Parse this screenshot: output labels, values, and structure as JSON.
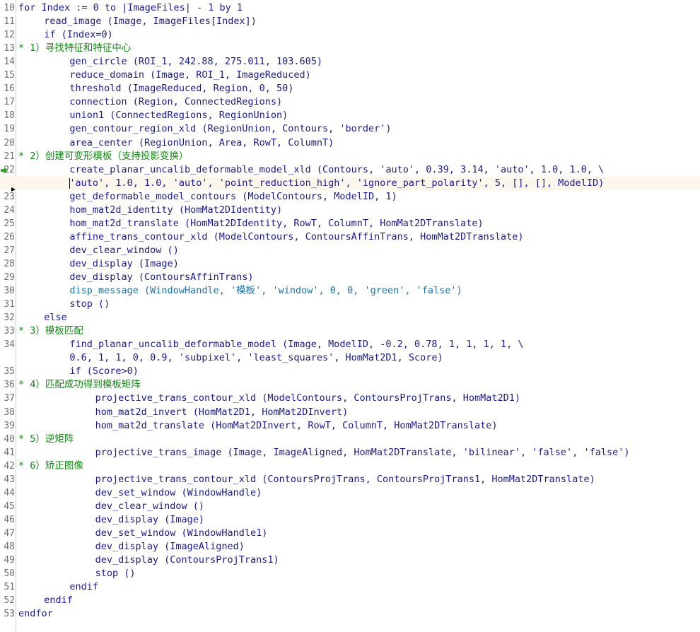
{
  "editor": {
    "current_line_index": 13,
    "lines": [
      {
        "n": "10",
        "indent": 0,
        "type": "code",
        "text": "for Index := 0 to |ImageFiles| - 1 by 1"
      },
      {
        "n": "11",
        "indent": 1,
        "type": "code",
        "text": "read_image (Image, ImageFiles[Index])"
      },
      {
        "n": "12",
        "indent": 1,
        "type": "code",
        "text": "if (Index=0)"
      },
      {
        "n": "13",
        "indent": 0,
        "type": "comment",
        "text": "* 1）寻找特征和特征中心"
      },
      {
        "n": "14",
        "indent": 2,
        "type": "code",
        "text": "gen_circle (ROI_1, 242.88, 275.011, 103.605)"
      },
      {
        "n": "15",
        "indent": 2,
        "type": "code",
        "text": "reduce_domain (Image, ROI_1, ImageReduced)"
      },
      {
        "n": "16",
        "indent": 2,
        "type": "code",
        "text": "threshold (ImageReduced, Region, 0, 50)"
      },
      {
        "n": "17",
        "indent": 2,
        "type": "code",
        "text": "connection (Region, ConnectedRegions)"
      },
      {
        "n": "18",
        "indent": 2,
        "type": "code",
        "text": "union1 (ConnectedRegions, RegionUnion)"
      },
      {
        "n": "19",
        "indent": 2,
        "type": "code",
        "text": "gen_contour_region_xld (RegionUnion, Contours, 'border')"
      },
      {
        "n": "20",
        "indent": 2,
        "type": "code",
        "text": "area_center (RegionUnion, Area, RowT, ColumnT)"
      },
      {
        "n": "21",
        "indent": 0,
        "type": "comment",
        "text": "* 2）创建可变形模板（支持投影变换）"
      },
      {
        "n": "22",
        "indent": 2,
        "type": "code",
        "text": "create_planar_uncalib_deformable_model_xld (Contours, 'auto', 0.39, 3.14, 'auto', 1.0, 1.0, \\"
      },
      {
        "n": "",
        "indent": 2,
        "type": "code",
        "text": "'auto', 1.0, 1.0, 'auto', 'point_reduction_high', 'ignore_part_polarity', 5, [], [], ModelID)"
      },
      {
        "n": "23",
        "indent": 2,
        "type": "code",
        "text": "get_deformable_model_contours (ModelContours, ModelID, 1)"
      },
      {
        "n": "24",
        "indent": 2,
        "type": "code",
        "text": "hom_mat2d_identity (HomMat2DIdentity)"
      },
      {
        "n": "25",
        "indent": 2,
        "type": "code",
        "text": "hom_mat2d_translate (HomMat2DIdentity, RowT, ColumnT, HomMat2DTranslate)"
      },
      {
        "n": "26",
        "indent": 2,
        "type": "code",
        "text": "affine_trans_contour_xld (ModelContours, ContoursAffinTrans, HomMat2DTranslate)"
      },
      {
        "n": "27",
        "indent": 2,
        "type": "code",
        "text": "dev_clear_window ()"
      },
      {
        "n": "28",
        "indent": 2,
        "type": "code",
        "text": "dev_display (Image)"
      },
      {
        "n": "29",
        "indent": 2,
        "type": "code",
        "text": "dev_display (ContoursAffinTrans)"
      },
      {
        "n": "30",
        "indent": 2,
        "type": "dispmsg",
        "text": "disp_message (WindowHandle, '模板', 'window', 0, 0, 'green', 'false')"
      },
      {
        "n": "31",
        "indent": 2,
        "type": "code",
        "text": "stop ()"
      },
      {
        "n": "32",
        "indent": 1,
        "type": "code",
        "text": "else"
      },
      {
        "n": "33",
        "indent": 0,
        "type": "comment",
        "text": "* 3）模板匹配"
      },
      {
        "n": "34",
        "indent": 2,
        "type": "code",
        "text": "find_planar_uncalib_deformable_model (Image, ModelID, -0.2, 0.78, 1, 1, 1, 1, \\"
      },
      {
        "n": "",
        "indent": 2,
        "type": "code",
        "text": "0.6, 1, 1, 0, 0.9, 'subpixel', 'least_squares', HomMat2D1, Score)"
      },
      {
        "n": "35",
        "indent": 2,
        "type": "code",
        "text": "if (Score>0)"
      },
      {
        "n": "36",
        "indent": 0,
        "type": "comment",
        "text": "* 4）匹配成功得到模板矩阵"
      },
      {
        "n": "37",
        "indent": 3,
        "type": "code",
        "text": "projective_trans_contour_xld (ModelContours, ContoursProjTrans, HomMat2D1)"
      },
      {
        "n": "38",
        "indent": 3,
        "type": "code",
        "text": "hom_mat2d_invert (HomMat2D1, HomMat2DInvert)"
      },
      {
        "n": "39",
        "indent": 3,
        "type": "code",
        "text": "hom_mat2d_translate (HomMat2DInvert, RowT, ColumnT, HomMat2DTranslate)"
      },
      {
        "n": "40",
        "indent": 0,
        "type": "comment",
        "text": "* 5）逆矩阵"
      },
      {
        "n": "41",
        "indent": 3,
        "type": "code",
        "text": "projective_trans_image (Image, ImageAligned, HomMat2DTranslate, 'bilinear', 'false', 'false')"
      },
      {
        "n": "42",
        "indent": 0,
        "type": "comment",
        "text": "* 6）矫正图像"
      },
      {
        "n": "43",
        "indent": 3,
        "type": "code",
        "text": "projective_trans_contour_xld (ContoursProjTrans, ContoursProjTrans1, HomMat2DTranslate)"
      },
      {
        "n": "44",
        "indent": 3,
        "type": "code",
        "text": "dev_set_window (WindowHandle)"
      },
      {
        "n": "45",
        "indent": 3,
        "type": "code",
        "text": "dev_clear_window ()"
      },
      {
        "n": "46",
        "indent": 3,
        "type": "code",
        "text": "dev_display (Image)"
      },
      {
        "n": "47",
        "indent": 3,
        "type": "code",
        "text": "dev_set_window (WindowHandle1)"
      },
      {
        "n": "48",
        "indent": 3,
        "type": "code",
        "text": "dev_display (ImageAligned)"
      },
      {
        "n": "49",
        "indent": 3,
        "type": "code",
        "text": "dev_display (ContoursProjTrans1)"
      },
      {
        "n": "50",
        "indent": 3,
        "type": "code",
        "text": "stop ()"
      },
      {
        "n": "51",
        "indent": 2,
        "type": "code",
        "text": "endif"
      },
      {
        "n": "52",
        "indent": 1,
        "type": "code",
        "text": "endif"
      },
      {
        "n": "53",
        "indent": 0,
        "type": "code",
        "text": "endfor"
      }
    ]
  },
  "gutter": {
    "exec_marker_icon": "program-counter-arrow-icon",
    "exec_marker_color": "#3aa52a",
    "break_marker_icon": "insert-cursor-triangle-icon"
  },
  "colors": {
    "code": "#1a1a8f",
    "comment": "#118a11",
    "current_line_bg": "#fdf6ec",
    "line_number": "#6f6f6f"
  }
}
